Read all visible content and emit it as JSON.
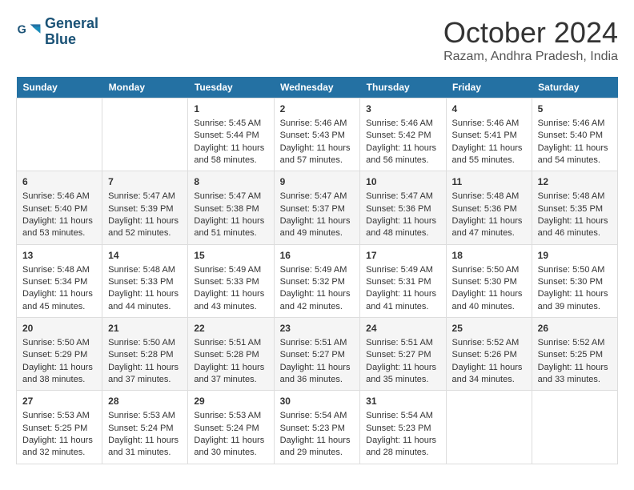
{
  "logo": {
    "line1": "General",
    "line2": "Blue"
  },
  "title": "October 2024",
  "location": "Razam, Andhra Pradesh, India",
  "headers": [
    "Sunday",
    "Monday",
    "Tuesday",
    "Wednesday",
    "Thursday",
    "Friday",
    "Saturday"
  ],
  "weeks": [
    [
      {
        "day": "",
        "info": ""
      },
      {
        "day": "",
        "info": ""
      },
      {
        "day": "1",
        "info": "Sunrise: 5:45 AM\nSunset: 5:44 PM\nDaylight: 11 hours and 58 minutes."
      },
      {
        "day": "2",
        "info": "Sunrise: 5:46 AM\nSunset: 5:43 PM\nDaylight: 11 hours and 57 minutes."
      },
      {
        "day": "3",
        "info": "Sunrise: 5:46 AM\nSunset: 5:42 PM\nDaylight: 11 hours and 56 minutes."
      },
      {
        "day": "4",
        "info": "Sunrise: 5:46 AM\nSunset: 5:41 PM\nDaylight: 11 hours and 55 minutes."
      },
      {
        "day": "5",
        "info": "Sunrise: 5:46 AM\nSunset: 5:40 PM\nDaylight: 11 hours and 54 minutes."
      }
    ],
    [
      {
        "day": "6",
        "info": "Sunrise: 5:46 AM\nSunset: 5:40 PM\nDaylight: 11 hours and 53 minutes."
      },
      {
        "day": "7",
        "info": "Sunrise: 5:47 AM\nSunset: 5:39 PM\nDaylight: 11 hours and 52 minutes."
      },
      {
        "day": "8",
        "info": "Sunrise: 5:47 AM\nSunset: 5:38 PM\nDaylight: 11 hours and 51 minutes."
      },
      {
        "day": "9",
        "info": "Sunrise: 5:47 AM\nSunset: 5:37 PM\nDaylight: 11 hours and 49 minutes."
      },
      {
        "day": "10",
        "info": "Sunrise: 5:47 AM\nSunset: 5:36 PM\nDaylight: 11 hours and 48 minutes."
      },
      {
        "day": "11",
        "info": "Sunrise: 5:48 AM\nSunset: 5:36 PM\nDaylight: 11 hours and 47 minutes."
      },
      {
        "day": "12",
        "info": "Sunrise: 5:48 AM\nSunset: 5:35 PM\nDaylight: 11 hours and 46 minutes."
      }
    ],
    [
      {
        "day": "13",
        "info": "Sunrise: 5:48 AM\nSunset: 5:34 PM\nDaylight: 11 hours and 45 minutes."
      },
      {
        "day": "14",
        "info": "Sunrise: 5:48 AM\nSunset: 5:33 PM\nDaylight: 11 hours and 44 minutes."
      },
      {
        "day": "15",
        "info": "Sunrise: 5:49 AM\nSunset: 5:33 PM\nDaylight: 11 hours and 43 minutes."
      },
      {
        "day": "16",
        "info": "Sunrise: 5:49 AM\nSunset: 5:32 PM\nDaylight: 11 hours and 42 minutes."
      },
      {
        "day": "17",
        "info": "Sunrise: 5:49 AM\nSunset: 5:31 PM\nDaylight: 11 hours and 41 minutes."
      },
      {
        "day": "18",
        "info": "Sunrise: 5:50 AM\nSunset: 5:30 PM\nDaylight: 11 hours and 40 minutes."
      },
      {
        "day": "19",
        "info": "Sunrise: 5:50 AM\nSunset: 5:30 PM\nDaylight: 11 hours and 39 minutes."
      }
    ],
    [
      {
        "day": "20",
        "info": "Sunrise: 5:50 AM\nSunset: 5:29 PM\nDaylight: 11 hours and 38 minutes."
      },
      {
        "day": "21",
        "info": "Sunrise: 5:50 AM\nSunset: 5:28 PM\nDaylight: 11 hours and 37 minutes."
      },
      {
        "day": "22",
        "info": "Sunrise: 5:51 AM\nSunset: 5:28 PM\nDaylight: 11 hours and 37 minutes."
      },
      {
        "day": "23",
        "info": "Sunrise: 5:51 AM\nSunset: 5:27 PM\nDaylight: 11 hours and 36 minutes."
      },
      {
        "day": "24",
        "info": "Sunrise: 5:51 AM\nSunset: 5:27 PM\nDaylight: 11 hours and 35 minutes."
      },
      {
        "day": "25",
        "info": "Sunrise: 5:52 AM\nSunset: 5:26 PM\nDaylight: 11 hours and 34 minutes."
      },
      {
        "day": "26",
        "info": "Sunrise: 5:52 AM\nSunset: 5:25 PM\nDaylight: 11 hours and 33 minutes."
      }
    ],
    [
      {
        "day": "27",
        "info": "Sunrise: 5:53 AM\nSunset: 5:25 PM\nDaylight: 11 hours and 32 minutes."
      },
      {
        "day": "28",
        "info": "Sunrise: 5:53 AM\nSunset: 5:24 PM\nDaylight: 11 hours and 31 minutes."
      },
      {
        "day": "29",
        "info": "Sunrise: 5:53 AM\nSunset: 5:24 PM\nDaylight: 11 hours and 30 minutes."
      },
      {
        "day": "30",
        "info": "Sunrise: 5:54 AM\nSunset: 5:23 PM\nDaylight: 11 hours and 29 minutes."
      },
      {
        "day": "31",
        "info": "Sunrise: 5:54 AM\nSunset: 5:23 PM\nDaylight: 11 hours and 28 minutes."
      },
      {
        "day": "",
        "info": ""
      },
      {
        "day": "",
        "info": ""
      }
    ]
  ]
}
